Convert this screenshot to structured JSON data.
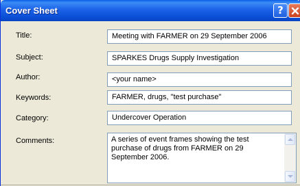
{
  "window": {
    "title": "Cover Sheet",
    "help_label": "?"
  },
  "fields": {
    "title": {
      "label": "Title:",
      "value": "Meeting with FARMER on 29 September 2006"
    },
    "subject": {
      "label": "Subject:",
      "value": "SPARKES Drugs Supply Investigation"
    },
    "author": {
      "label": "Author:",
      "value": "<your name>"
    },
    "keywords": {
      "label": "Keywords:",
      "value": "FARMER, drugs, \"test purchase\""
    },
    "category": {
      "label": "Category:",
      "value": "Undercover Operation"
    },
    "comments": {
      "label": "Comments:",
      "value": "A series of event frames showing the test purchase of drugs from FARMER on 29 September 2006."
    }
  },
  "icons": {
    "help": "help-icon",
    "close": "close-icon",
    "scroll_up": "scroll-up-icon",
    "scroll_down": "scroll-down-icon"
  },
  "colors": {
    "titlebar": "#0a4fd6",
    "close_button": "#c8421e",
    "dialog_background": "#ece9d8",
    "field_border": "#7f9db9"
  }
}
